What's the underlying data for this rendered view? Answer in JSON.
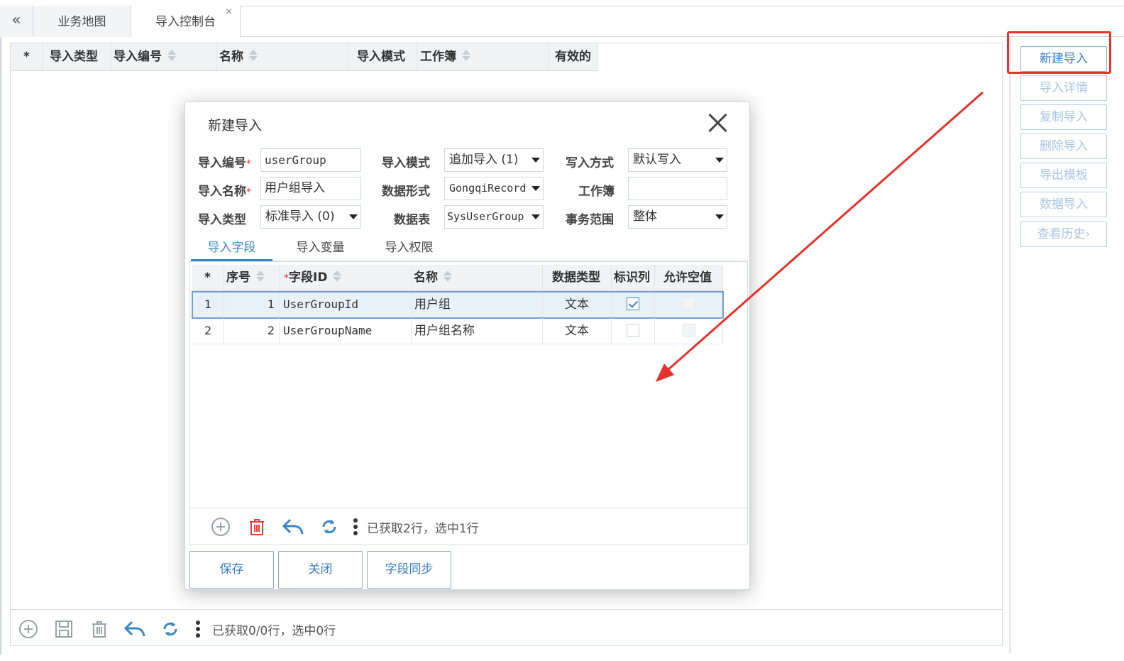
{
  "tabs": {
    "collapse_glyph": "«",
    "items": [
      {
        "label": "业务地图"
      },
      {
        "label": "导入控制台",
        "close": "×"
      }
    ]
  },
  "main_grid": {
    "columns": [
      "*",
      "导入类型",
      "导入编号",
      "名称",
      "导入模式",
      "工作簿",
      "有效的"
    ],
    "rows": [],
    "status": "已获取0/0行，选中0行"
  },
  "side_buttons": [
    {
      "label": "新建导入",
      "enabled": true
    },
    {
      "label": "导入详情",
      "enabled": false
    },
    {
      "label": "复制导入",
      "enabled": false
    },
    {
      "label": "删除导入",
      "enabled": false
    },
    {
      "label": "导出模板",
      "enabled": false
    },
    {
      "label": "数据导入",
      "enabled": false
    },
    {
      "label": "查看历史›",
      "enabled": false
    }
  ],
  "modal": {
    "title": "新建导入",
    "fields": {
      "import_code": {
        "label": "导入编号",
        "value": "userGroup",
        "required": "*"
      },
      "import_name": {
        "label": "导入名称",
        "value": "用户组导入",
        "required": "*"
      },
      "import_type": {
        "label": "导入类型",
        "value": "标准导入 (0)"
      },
      "import_mode": {
        "label": "导入模式",
        "value": "追加导入 (1)"
      },
      "data_format": {
        "label": "数据形式",
        "value": "GongqiRecord"
      },
      "data_table": {
        "label": "数据表",
        "value": "SysUserGroup"
      },
      "write_mode": {
        "label": "写入方式",
        "value": "默认写入"
      },
      "workbook": {
        "label": "工作簿",
        "value": ""
      },
      "tx_scope": {
        "label": "事务范围",
        "value": "整体"
      }
    },
    "tabs": [
      "导入字段",
      "导入变量",
      "导入权限"
    ],
    "active_tab": "导入字段",
    "field_grid": {
      "columns": [
        "*",
        "序号",
        "字段ID",
        "名称",
        "数据类型",
        "标识列",
        "允许空值"
      ],
      "required_mark": "*",
      "rows": [
        {
          "row": "1",
          "seq": "1",
          "field_id": "UserGroupId",
          "name": "用户组",
          "type": "文本",
          "identity": true,
          "nullable": false,
          "selected": true
        },
        {
          "row": "2",
          "seq": "2",
          "field_id": "UserGroupName",
          "name": "用户组名称",
          "type": "文本",
          "identity": false,
          "nullable": false,
          "selected": false
        }
      ],
      "status": "已获取2行，选中1行"
    },
    "buttons": {
      "save": "保存",
      "close": "关闭",
      "sync": "字段同步"
    }
  },
  "annotation": {
    "highlight_color": "#e8312a",
    "accent_color": "#3a87c8"
  }
}
